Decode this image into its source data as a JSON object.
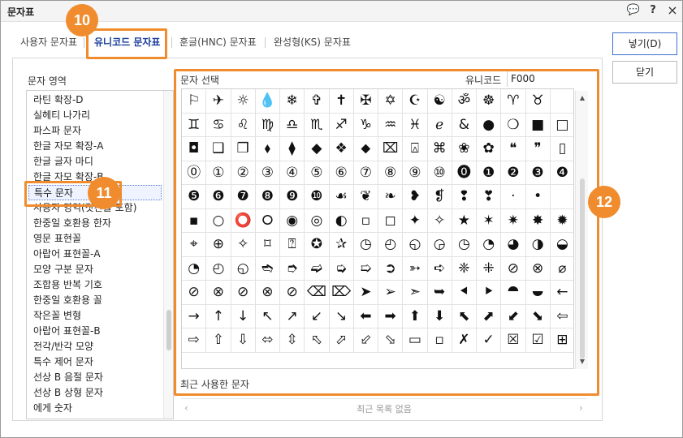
{
  "window": {
    "title": "문자표",
    "chat_icon": "💬",
    "help": "?",
    "close": "×"
  },
  "tabs": [
    {
      "label": "사용자 문자표"
    },
    {
      "label": "유니코드 문자표"
    },
    {
      "label": "훈글(HNC) 문자표"
    },
    {
      "label": "완성형(KS) 문자표"
    }
  ],
  "buttons": {
    "insert": "넣기(D)",
    "close": "닫기"
  },
  "area": {
    "label": "문자 영역",
    "items": [
      "라틴 확장-D",
      "실헤티 나가리",
      "파스파 문자",
      "한글 자모 확장-A",
      "한글 글자 마디",
      "한글 자모 확장-B",
      "특수 문자",
      "사용자 영역(잣찬를 포함)",
      "한중일 호환용 한자",
      "영문 표현꼴",
      "아랍어 표현꼴-A",
      "모양 구분 문자",
      "조합용 반복 기호",
      "한중일 호환용 꼴",
      "작은꼴 변형",
      "아랍어 표현꼴-B",
      "전각/반각 모양",
      "특수 제어 문자",
      "선상 B 음절 문자",
      "선상 B 상형 문자",
      "에게 숫자"
    ],
    "selected_index": 6
  },
  "selection": {
    "label": "문자 선택",
    "unicode_label": "유니코드",
    "unicode_value": "F000"
  },
  "chars": [
    "⚐",
    "✈",
    "☼",
    "💧",
    "❄",
    "✞",
    "✝",
    "✠",
    "✡",
    "☪",
    "☯",
    "ॐ",
    "☸",
    "♈",
    "♉",
    "",
    "♊",
    "♋",
    "♌",
    "♍",
    "♎",
    "♏",
    "♐",
    "♑",
    "♒",
    "♓",
    "ℯ",
    "&",
    "●",
    "❍",
    "■",
    "□",
    "◘",
    "❑",
    "❒",
    "⬧",
    "⧫",
    "◆",
    "❖",
    "⬥",
    "⌧",
    "⍓",
    "⌘",
    "❀",
    "✿",
    "❝",
    "❞",
    "▯",
    "⓪",
    "①",
    "②",
    "③",
    "④",
    "⑤",
    "⑥",
    "⑦",
    "⑧",
    "⑨",
    "⑩",
    "⓿",
    "❶",
    "❷",
    "❸",
    "❹",
    "❺",
    "❻",
    "❼",
    "❽",
    "❾",
    "❿",
    "☙",
    "❦",
    "❧",
    "❥",
    "❡",
    "❢",
    "❣",
    "·",
    "•",
    "",
    "▪",
    "○",
    "⭕",
    "⭘",
    "◉",
    "◎",
    "◐",
    "▫",
    "◻",
    "✦",
    "✧",
    "★",
    "✶",
    "✷",
    "✸",
    "✹",
    "⌖",
    "⊕",
    "✧",
    "⌑",
    "⍰",
    "✪",
    "✰",
    "◷",
    "◴",
    "◵",
    "◶",
    "◷",
    "◔",
    "◕",
    "◑",
    "◒",
    "◔",
    "◴",
    "◵",
    "➬",
    "➮",
    "➫",
    "➭",
    "➯",
    "➲",
    "➳",
    "➪",
    "❈",
    "⁜",
    "⊘",
    "⊗",
    "⌀",
    "⊘",
    "⊗",
    "⊘",
    "⊗",
    "⊘",
    "⌫",
    "⌦",
    "➤",
    "➢",
    "➣",
    "➥",
    "⯇",
    "⯈",
    "⯊",
    "⯋",
    "←",
    "→",
    "↑",
    "↓",
    "↖",
    "↗",
    "↙",
    "↘",
    "⬅",
    "➡",
    "⬆",
    "⬇",
    "⬉",
    "⬈",
    "⬋",
    "⬊",
    "⇦",
    "⇨",
    "⇧",
    "⇩",
    "⬄",
    "⇳",
    "⬁",
    "⬀",
    "⬃",
    "⬂",
    "▭",
    "▫",
    "✗",
    "✓",
    "☒",
    "☑",
    "⊞"
  ],
  "recent": {
    "label": "최근 사용한 문자",
    "empty": "최근 목록 없음"
  },
  "annotations": {
    "tab": "10",
    "list": "11",
    "grid": "12"
  },
  "colors": {
    "highlight": "#f08c2e",
    "accent": "#1a3e9a"
  }
}
